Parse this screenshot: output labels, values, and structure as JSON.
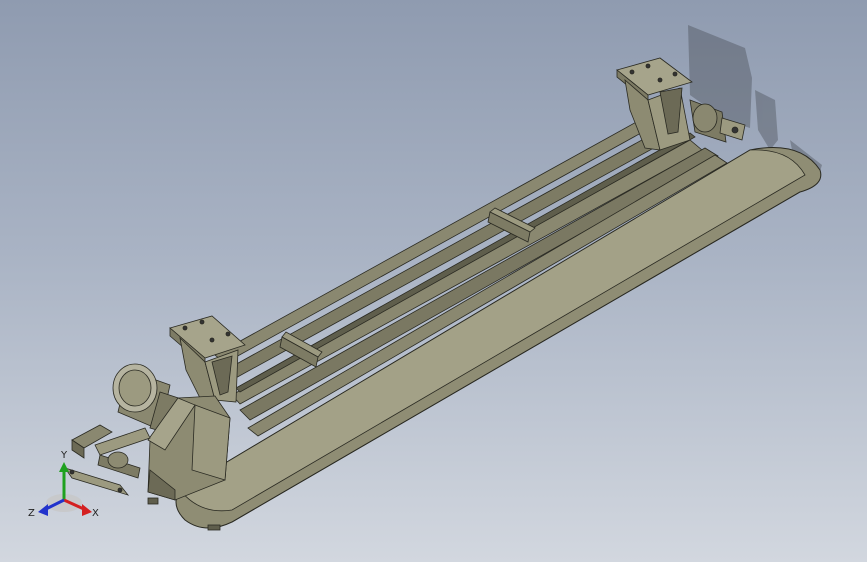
{
  "triad": {
    "x_label": "X",
    "y_label": "Y",
    "z_label": "Z",
    "x_color": "#d42020",
    "y_color": "#1fa11f",
    "z_color": "#2233cc"
  },
  "colors": {
    "background_top": "#8f9bb0",
    "background_bottom": "#d2d7df",
    "model_body": "#8d8b72",
    "model_edge": "#2a2a22"
  }
}
